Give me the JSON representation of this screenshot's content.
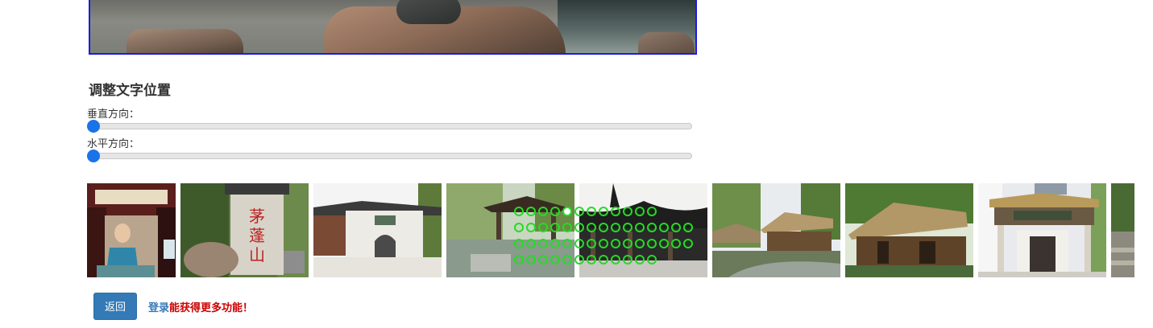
{
  "header_photo": {
    "icon": "rocks-and-water-photo"
  },
  "text_position": {
    "title": "调整文字位置",
    "vertical_label": "垂直方向：",
    "vertical_value": 0,
    "horizontal_label": "水平方向：",
    "horizontal_value": 0
  },
  "gallery": {
    "items": [
      {
        "icon": "shrine-statue-photo"
      },
      {
        "icon": "stone-tablet-photo"
      },
      {
        "icon": "white-gate-photo"
      },
      {
        "icon": "pavilion-by-water-photo"
      },
      {
        "icon": "temple-roof-photo"
      },
      {
        "icon": "thatched-huts-photo"
      },
      {
        "icon": "thatched-cottages-photo"
      },
      {
        "icon": "memorial-hall-photo"
      },
      {
        "icon": "garden-path-photo"
      }
    ],
    "active_dot_index": 4
  },
  "actions": {
    "back_label": "返回",
    "login_link": "登录",
    "login_hint": "能获得更多功能！"
  },
  "colors": {
    "accent": "#337ab7",
    "slider_thumb": "#1a73e8",
    "photo_border": "#1a1ae6",
    "dot_green": "#22dd22",
    "hint_red": "#cc0000"
  }
}
